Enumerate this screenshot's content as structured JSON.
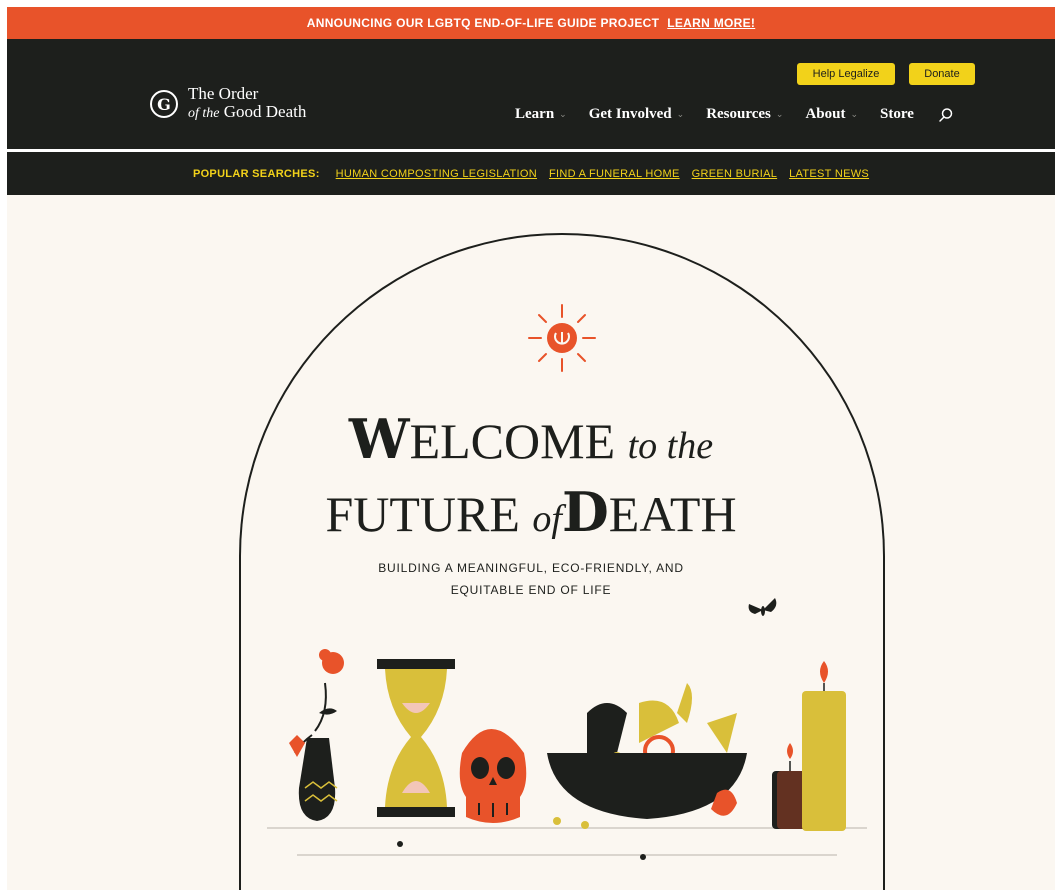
{
  "announcement": {
    "text": "ANNOUNCING OUR LGBTQ END-OF-LIFE GUIDE PROJECT",
    "link": "LEARN MORE!"
  },
  "logo": {
    "line1": "The Order",
    "line2_italic": "of the",
    "line2": "Good Death"
  },
  "header_buttons": {
    "help_legalize": "Help Legalize",
    "donate": "Donate"
  },
  "nav": [
    {
      "label": "Learn",
      "has_dropdown": true
    },
    {
      "label": "Get Involved",
      "has_dropdown": true
    },
    {
      "label": "Resources",
      "has_dropdown": true
    },
    {
      "label": "About",
      "has_dropdown": true
    },
    {
      "label": "Store",
      "has_dropdown": false
    }
  ],
  "popular": {
    "label": "POPULAR SEARCHES:",
    "links": [
      "HUMAN COMPOSTING LEGISLATION",
      "FIND A FUNERAL HOME",
      "GREEN BURIAL",
      "LATEST NEWS"
    ]
  },
  "hero": {
    "title_line1_cap": "W",
    "title_line1_rest": "ELCOME",
    "title_line1_italic": "to the",
    "title_line2_start": "FUTURE",
    "title_line2_italic": "of",
    "title_line2_cap": "D",
    "title_line2_rest": "EATH",
    "subtitle_line1": "BUILDING A MEANINGFUL, ECO-FRIENDLY, AND",
    "subtitle_line2": "EQUITABLE END OF LIFE"
  },
  "colors": {
    "accent_orange": "#e8532a",
    "dark": "#1d1f1c",
    "yellow": "#f2d21a",
    "cream": "#fbf7f1",
    "mustard": "#d9bf3a"
  },
  "icons": {
    "search": "search-icon",
    "dropdown": "chevron-down-icon",
    "sun_logo": "sun-logo-icon",
    "moth": "moth-icon"
  }
}
